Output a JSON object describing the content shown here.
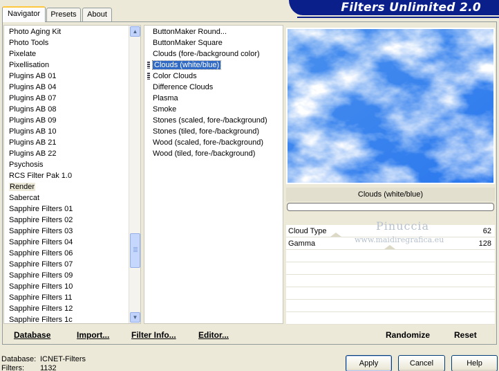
{
  "tabs": [
    {
      "label": "Navigator"
    },
    {
      "label": "Presets"
    },
    {
      "label": "About"
    }
  ],
  "banner": {
    "title": "Filters Unlimited 2.0"
  },
  "categories": {
    "items": [
      "Photo Aging Kit",
      "Photo Tools",
      "Pixelate",
      "Pixellisation",
      "Plugins AB 01",
      "Plugins AB 04",
      "Plugins AB 07",
      "Plugins AB 08",
      "Plugins AB 09",
      "Plugins AB 10",
      "Plugins AB 21",
      "Plugins AB 22",
      "Psychosis",
      "RCS Filter Pak 1.0",
      "Render",
      "Sabercat",
      "Sapphire Filters 01",
      "Sapphire Filters 02",
      "Sapphire Filters 03",
      "Sapphire Filters 04",
      "Sapphire Filters 06",
      "Sapphire Filters 07",
      "Sapphire Filters 09",
      "Sapphire Filters 10",
      "Sapphire Filters 11",
      "Sapphire Filters 12",
      "Sapphire Filters 1c"
    ],
    "selected": "Render"
  },
  "filters": {
    "items": [
      "ButtonMaker Round...",
      "ButtonMaker Square",
      "Clouds (fore-/background color)",
      "Clouds (white/blue)",
      "Color Clouds",
      "Difference Clouds",
      "Plasma",
      "Smoke",
      "Stones (scaled, fore-/background)",
      "Stones (tiled, fore-/background)",
      "Wood (scaled, fore-/background)",
      "Wood (tiled, fore-/background)"
    ],
    "selected": "Clouds (white/blue)"
  },
  "preview": {
    "filter_name": "Clouds (white/blue)",
    "progress": 0
  },
  "params": [
    {
      "label": "Cloud Type",
      "value": "62"
    },
    {
      "label": "Gamma",
      "value": "128"
    }
  ],
  "watermark": {
    "line1": "Pinuccia",
    "line2": "www.maidiregrafica.eu"
  },
  "actions": {
    "database": "Database",
    "import": "Import...",
    "filter_info": "Filter Info...",
    "editor": "Editor...",
    "randomize": "Randomize",
    "reset": "Reset"
  },
  "status": {
    "database_label": "Database:",
    "database_value": "ICNET-Filters",
    "filters_label": "Filters:",
    "filters_value": "1132"
  },
  "buttons": {
    "apply": "Apply",
    "cancel": "Cancel",
    "help": "Help"
  },
  "icons": {
    "scroll_up": "chevron-up-icon",
    "scroll_down": "chevron-down-icon",
    "grip": "grip-icon"
  },
  "colors": {
    "selection": "#316ac5",
    "banner": "#0b1f8a",
    "preview_sky": "#3a86f0"
  }
}
